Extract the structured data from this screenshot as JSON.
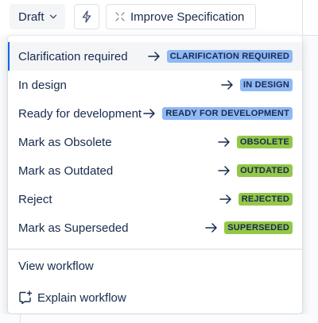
{
  "toolbar": {
    "status_label": "Draft",
    "improve_label": "Improve Specification"
  },
  "menu": {
    "transitions": [
      {
        "label": "Clarification required",
        "status": "CLARIFICATION REQUIRED",
        "color": "#8fb8f6",
        "active": true
      },
      {
        "label": "In design",
        "status": "IN DESIGN",
        "color": "#8fb8f6"
      },
      {
        "label": "Ready for development",
        "status": "READY FOR DEVELOPMENT",
        "color": "#8fb8f6"
      },
      {
        "label": "Mark as Obsolete",
        "status": "OBSOLETE",
        "color": "#94c748"
      },
      {
        "label": "Mark as Outdated",
        "status": "OUTDATED",
        "color": "#94c748"
      },
      {
        "label": "Reject",
        "status": "REJECTED",
        "color": "#94c748"
      },
      {
        "label": "Mark as Superseded",
        "status": "SUPERSEDED",
        "color": "#94c748"
      }
    ],
    "view_workflow": "View workflow",
    "explain_workflow": "Explain workflow"
  },
  "icons": {
    "status_chevron": "chevron-down-icon",
    "automation": "lightning-bolt-icon",
    "improve": "sparkle-icon",
    "transition_arrow": "arrow-right-icon",
    "explain": "sparkle-chat-icon"
  }
}
